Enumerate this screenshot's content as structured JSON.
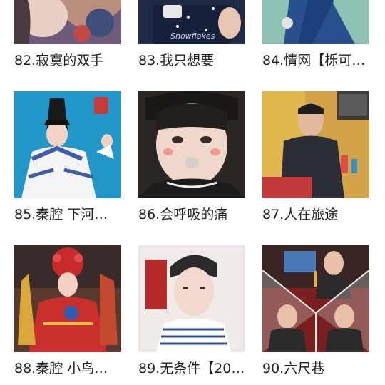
{
  "tracks": [
    {
      "title": "82.寂寞的双手"
    },
    {
      "title": "83.我只想要",
      "thumb_text": "Snowflakes"
    },
    {
      "title": "84.情网【栎可…"
    },
    {
      "title": "85.秦腔 下河…"
    },
    {
      "title": "86.会呼吸的痛"
    },
    {
      "title": "87.人在旅途"
    },
    {
      "title": "88.秦腔 小鸟…"
    },
    {
      "title": "89.无条件【20…"
    },
    {
      "title": "90.六尺巷"
    }
  ]
}
